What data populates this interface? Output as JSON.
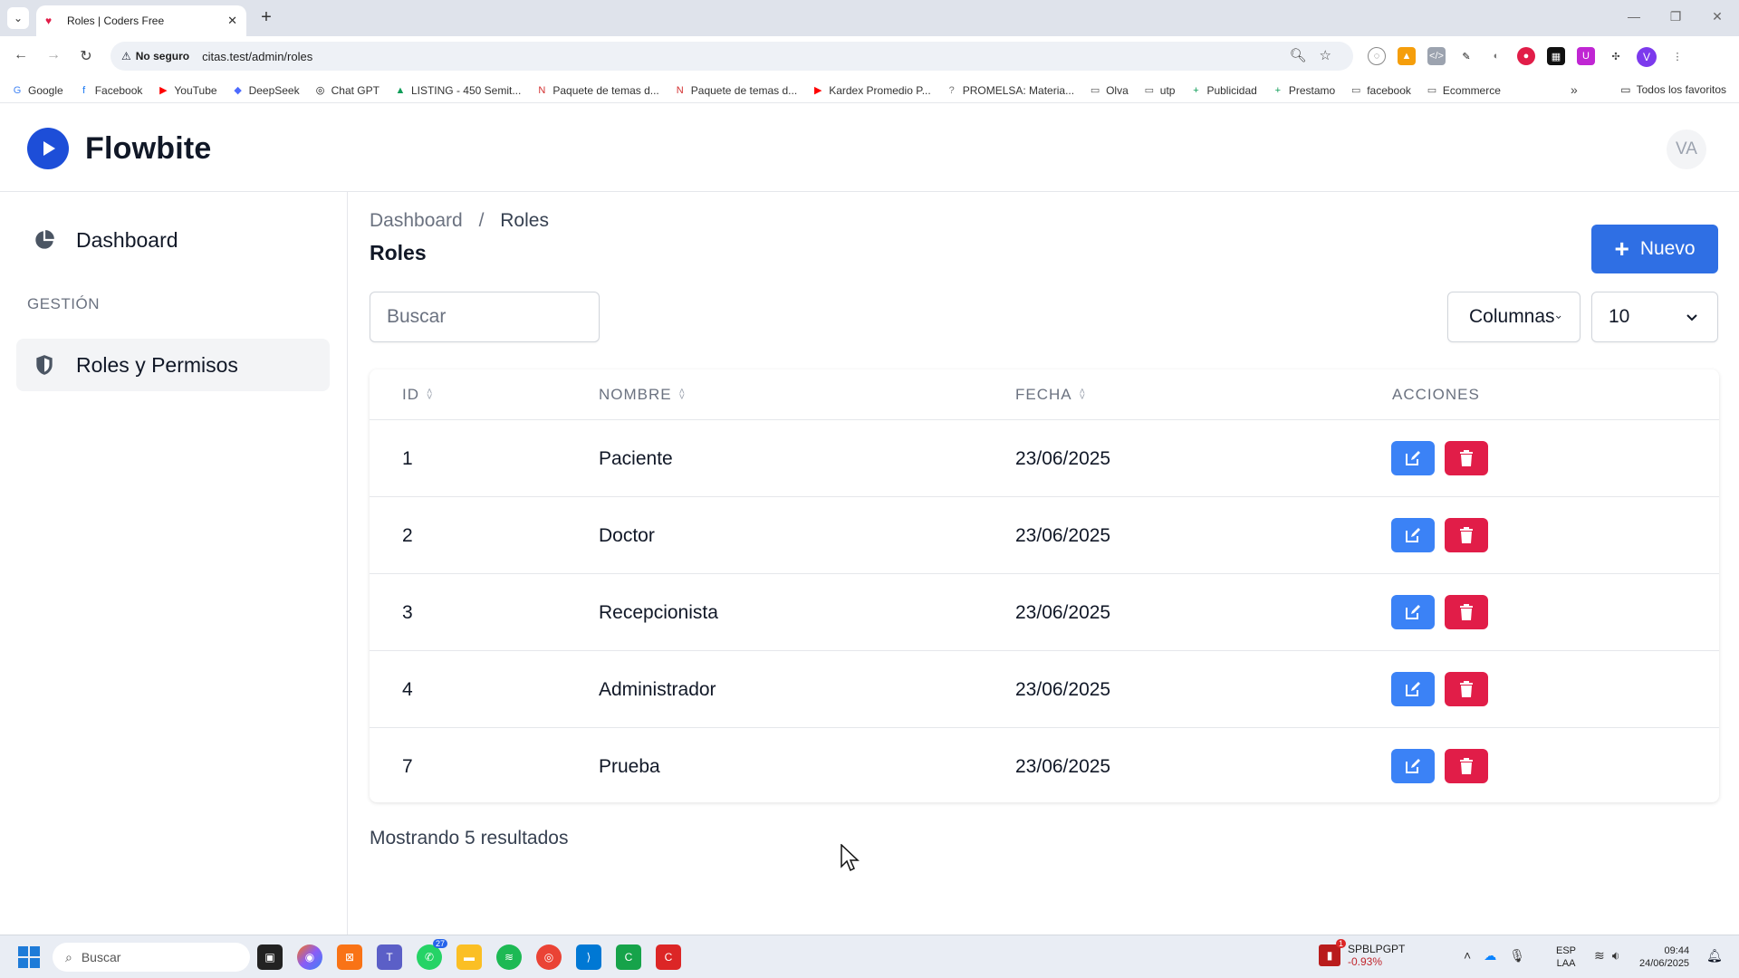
{
  "browser": {
    "tab_title": "Roles | Coders Free",
    "tab_close": "✕",
    "new_tab": "+",
    "security_label": "No seguro",
    "url": "citas.test/admin/roles",
    "profile_initial": "V",
    "bookmarks": [
      {
        "label": "Google",
        "icon": "G",
        "color": "#4285f4"
      },
      {
        "label": "Facebook",
        "icon": "f",
        "color": "#1877f2"
      },
      {
        "label": "YouTube",
        "icon": "▶",
        "color": "#ff0000"
      },
      {
        "label": "DeepSeek",
        "icon": "◆",
        "color": "#4d6bfe"
      },
      {
        "label": "Chat GPT",
        "icon": "◎",
        "color": "#111111"
      },
      {
        "label": "LISTING - 450 Semit...",
        "icon": "▲",
        "color": "#0f9d58"
      },
      {
        "label": "Paquete de temas d...",
        "icon": "N",
        "color": "#d32f2f"
      },
      {
        "label": "Paquete de temas d...",
        "icon": "N",
        "color": "#d32f2f"
      },
      {
        "label": "Kardex Promedio P...",
        "icon": "▶",
        "color": "#ff0000"
      },
      {
        "label": "PROMELSA: Materia...",
        "icon": "?",
        "color": "#777777"
      },
      {
        "label": "Olva",
        "icon": "▭",
        "color": "#555555"
      },
      {
        "label": "utp",
        "icon": "▭",
        "color": "#555555"
      },
      {
        "label": "Publicidad",
        "icon": "+",
        "color": "#0f9d58"
      },
      {
        "label": "Prestamo",
        "icon": "+",
        "color": "#0f9d58"
      },
      {
        "label": "facebook",
        "icon": "▭",
        "color": "#555555"
      },
      {
        "label": "Ecommerce",
        "icon": "▭",
        "color": "#555555"
      }
    ],
    "bookmarks_more": "»",
    "all_bookmarks": "Todos los favoritos"
  },
  "app": {
    "brand": "Flowbite",
    "user_initials": "VA",
    "accent_color": "#2f6fe4",
    "danger_color": "#e11d48"
  },
  "sidebar": {
    "dashboard_label": "Dashboard",
    "section_heading": "GESTIÓN",
    "roles_label": "Roles y Permisos"
  },
  "main": {
    "breadcrumb": {
      "parent": "Dashboard",
      "separator": "/",
      "current": "Roles"
    },
    "title": "Roles",
    "new_button_label": "Nuevo",
    "search_placeholder": "Buscar",
    "columns_label": "Columnas",
    "per_page_value": "10",
    "table": {
      "headers": {
        "id": "ID",
        "name": "NOMBRE",
        "date": "FECHA",
        "actions": "ACCIONES"
      },
      "rows": [
        {
          "id": "1",
          "name": "Paciente",
          "date": "23/06/2025"
        },
        {
          "id": "2",
          "name": "Doctor",
          "date": "23/06/2025"
        },
        {
          "id": "3",
          "name": "Recepcionista",
          "date": "23/06/2025"
        },
        {
          "id": "4",
          "name": "Administrador",
          "date": "23/06/2025"
        },
        {
          "id": "7",
          "name": "Prueba",
          "date": "23/06/2025"
        }
      ]
    },
    "results_text": "Mostrando 5 resultados"
  },
  "taskbar": {
    "search_placeholder": "Buscar",
    "whatsapp_badge": "27",
    "stock_badge": "1",
    "stock_symbol": "SPBLPGPT",
    "stock_change": "-0.93%",
    "lang_line1": "ESP",
    "lang_line2": "LAA",
    "time": "09:44",
    "date": "24/06/2025"
  }
}
